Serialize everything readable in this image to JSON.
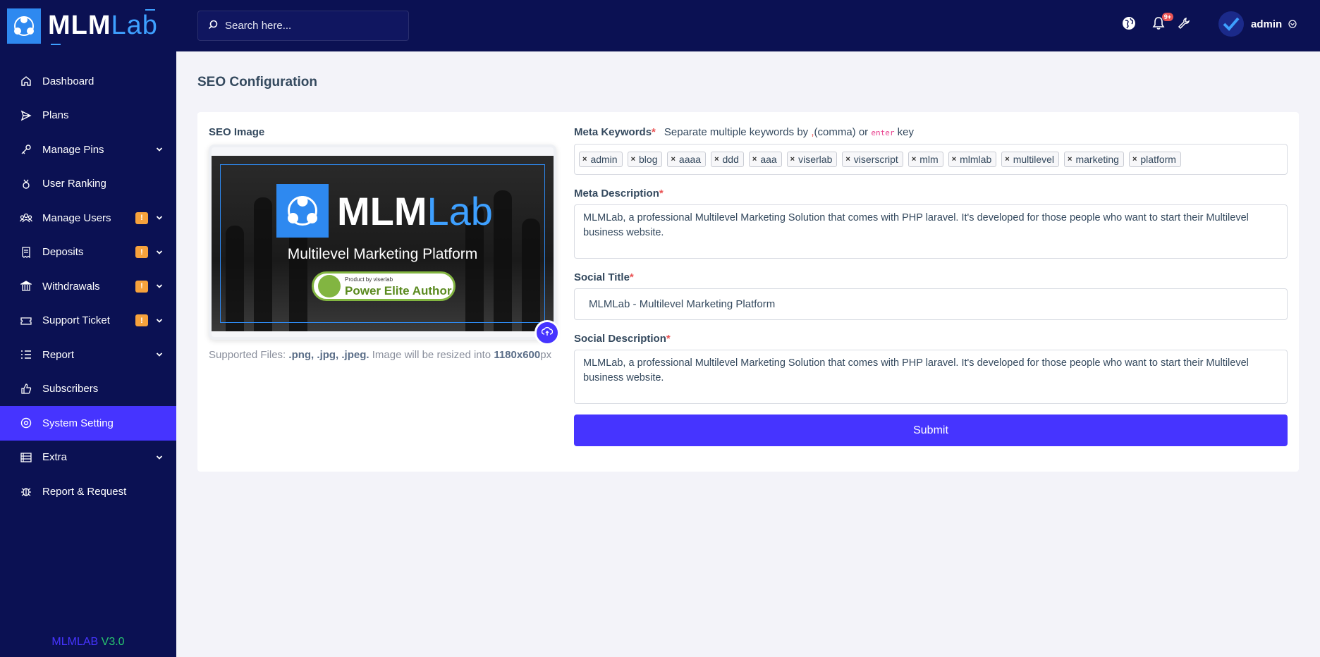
{
  "brand": {
    "part1": "MLM",
    "part2": "Lab"
  },
  "sidebar": {
    "items": [
      {
        "label": "Dashboard",
        "icon": "home-icon"
      },
      {
        "label": "Plans",
        "icon": "send-icon"
      },
      {
        "label": "Manage Pins",
        "icon": "key-icon",
        "has_submenu": true
      },
      {
        "label": "User Ranking",
        "icon": "medal-icon"
      },
      {
        "label": "Manage Users",
        "icon": "users-icon",
        "badge": "!",
        "has_submenu": true
      },
      {
        "label": "Deposits",
        "icon": "receipt-icon",
        "badge": "!",
        "has_submenu": true
      },
      {
        "label": "Withdrawals",
        "icon": "bank-icon",
        "badge": "!",
        "has_submenu": true
      },
      {
        "label": "Support Ticket",
        "icon": "ticket-icon",
        "badge": "!",
        "has_submenu": true
      },
      {
        "label": "Report",
        "icon": "list-icon",
        "has_submenu": true
      },
      {
        "label": "Subscribers",
        "icon": "thumbs-up-icon"
      },
      {
        "label": "System Setting",
        "icon": "settings-icon",
        "active": true
      },
      {
        "label": "Extra",
        "icon": "server-icon",
        "has_submenu": true
      },
      {
        "label": "Report & Request",
        "icon": "bug-icon"
      }
    ],
    "version_name": "MLMLAB",
    "version_number": "V3.0"
  },
  "topbar": {
    "search_placeholder": "Search here...",
    "notification_count": "9+",
    "user_name": "admin"
  },
  "page": {
    "title": "SEO Configuration",
    "seo_image": {
      "label": "SEO Image",
      "preview_brand_1": "MLM",
      "preview_brand_2": "Lab",
      "preview_subtitle": "Multilevel Marketing Platform",
      "preview_badge_small": "Product by viserlab",
      "preview_badge_big": "Power Elite Author",
      "supported_prefix": "Supported Files:",
      "supported_types": ".png, .jpg, .jpeg.",
      "resize_text": "Image will be resized into",
      "resize_size": "1180x600",
      "resize_unit": "px"
    },
    "meta_keywords": {
      "label": "Meta Keywords",
      "hint_prefix": "Separate multiple keywords by",
      "hint_comma": ",",
      "hint_middle": "(comma) or",
      "hint_code": "enter",
      "hint_suffix": "key",
      "tags": [
        "admin",
        "blog",
        "aaaa",
        "ddd",
        "aaa",
        "viserlab",
        "viserscript",
        "mlm",
        "mlmlab",
        "multilevel",
        "marketing",
        "platform"
      ]
    },
    "meta_description": {
      "label": "Meta Description",
      "value": "MLMLab, a professional Multilevel Marketing Solution that comes with PHP laravel. It's developed for those people who want to start their Multilevel business website."
    },
    "social_title": {
      "label": "Social Title",
      "value": "MLMLab - Multilevel Marketing Platform"
    },
    "social_description": {
      "label": "Social Description",
      "value": "MLMLab, a professional Multilevel Marketing Solution that comes with PHP laravel. It's developed for those people who want to start their Multilevel business website."
    },
    "submit_label": "Submit"
  },
  "colors": {
    "sidebar_bg": "#0b1153",
    "accent": "#4634ff",
    "badge": "#f7a23c",
    "danger": "#ea5455"
  }
}
